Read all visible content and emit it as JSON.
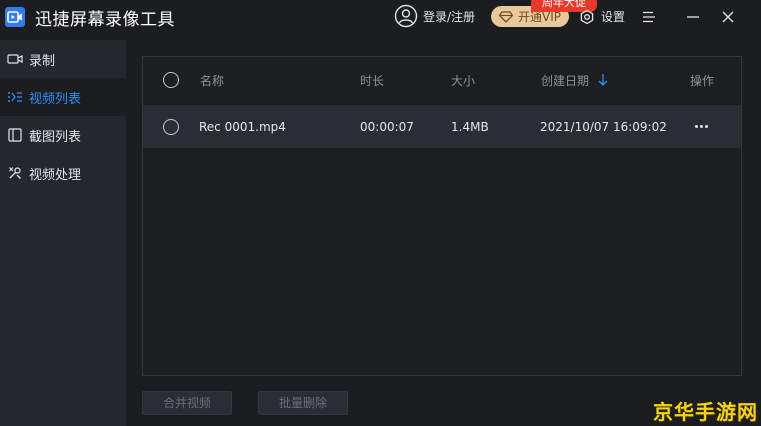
{
  "app": {
    "title": "迅捷屏幕录像工具",
    "login_label": "登录/注册",
    "vip_label": "开通VIP",
    "promo_badge": "周年大促",
    "settings_label": "设置"
  },
  "sidebar": {
    "items": [
      {
        "label": "录制",
        "icon": "video-camera-icon",
        "active": false
      },
      {
        "label": "视频列表",
        "icon": "list-icon",
        "active": true
      },
      {
        "label": "截图列表",
        "icon": "image-icon",
        "active": false
      },
      {
        "label": "视频处理",
        "icon": "tools-icon",
        "active": false
      }
    ]
  },
  "table": {
    "columns": {
      "name": "名称",
      "duration": "时长",
      "size": "大小",
      "created": "创建日期",
      "actions": "操作"
    },
    "sort_column": "created",
    "rows": [
      {
        "name": "Rec 0001.mp4",
        "duration": "00:00:07",
        "size": "1.4MB",
        "created": "2021/10/07 16:09:02"
      }
    ]
  },
  "footer": {
    "merge_label": "合并视频",
    "batch_delete_label": "批量删除"
  },
  "watermark": "京华手游网",
  "colors": {
    "accent": "#2f8ff7",
    "vip_gold": "#e9c89a",
    "promo_red": "#e8392b",
    "watermark_yellow": "#f3d21a"
  }
}
